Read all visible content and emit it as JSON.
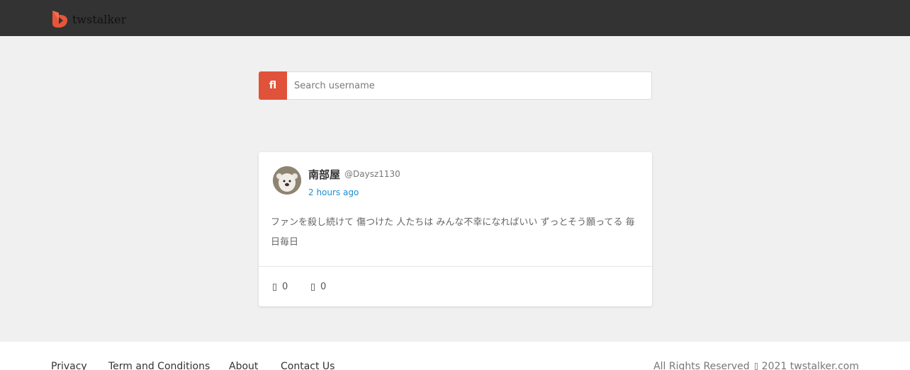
{
  "brand": {
    "name": "twstalker"
  },
  "search": {
    "button_glyph": "fl",
    "placeholder": "Search username",
    "value": ""
  },
  "post": {
    "display_name": "南部屋",
    "handle": "@Daysz1130",
    "time": "2 hours ago",
    "text": "ファンを殺し続けて 傷つけた 人たちは みんな不幸になればいい ずっとそう願ってる 毎日毎日",
    "likes": "0",
    "retweets": "0"
  },
  "footer": {
    "links": [
      "Privacy",
      "Term and Conditions",
      "About",
      "Contact Us"
    ],
    "all_rights": "All Rights Reserved",
    "copyright_text": "2021 twstalker.com"
  },
  "colors": {
    "topbar": "#333333",
    "accent": "#e0523a",
    "link": "#1a8fd1",
    "background": "#f0f0f0"
  }
}
